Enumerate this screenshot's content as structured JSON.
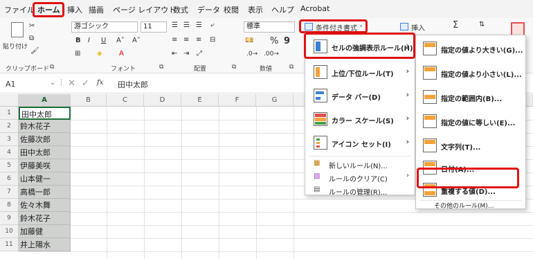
{
  "menubar": {
    "tabs": [
      "ファイル",
      "ホーム",
      "挿入",
      "描画",
      "ページ レイアウト",
      "数式",
      "データ",
      "校閲",
      "表示",
      "ヘルプ",
      "Acrobat"
    ],
    "active_tab": "ホーム"
  },
  "ribbon": {
    "paste_label": "貼り付け",
    "font_name": "游ゴシック",
    "font_size": "11",
    "number_format": "標準",
    "groups": [
      "クリップボード",
      "フォント",
      "配置",
      "数値"
    ],
    "cond_format_label": "条件付き書式",
    "insert_label": "挿入",
    "bold": "B",
    "italic": "I",
    "underline": "U",
    "percent": "%",
    "comma": "9"
  },
  "formula_bar": {
    "name_box": "A1",
    "fx": "fx",
    "content": "田中太郎"
  },
  "grid": {
    "columns": [
      "A",
      "B",
      "C",
      "D",
      "E",
      "F",
      "G"
    ],
    "rows": [
      "1",
      "2",
      "3",
      "4",
      "5",
      "6",
      "7",
      "8",
      "9",
      "10",
      "11"
    ],
    "cells": [
      "田中太郎",
      "鈴木花子",
      "佐藤次郎",
      "田中太郎",
      "伊藤美咲",
      "山本健一",
      "高橋一郎",
      "佐々木舞",
      "鈴木花子",
      "加藤健",
      "井上陽水"
    ]
  },
  "cf_menu": {
    "items": [
      {
        "label": "セルの強調表示ルール(H)",
        "icon": "highlight-rules-icon"
      },
      {
        "label": "上位/下位ルール(T)",
        "icon": "top-bottom-icon"
      },
      {
        "label": "データ バー(D)",
        "icon": "data-bar-icon"
      },
      {
        "label": "カラー スケール(S)",
        "icon": "color-scale-icon"
      },
      {
        "label": "アイコン セット(I)",
        "icon": "icon-set-icon"
      }
    ],
    "small_items": [
      "新しいルール(N)...",
      "ルールのクリア(C)",
      "ルールの管理(R)..."
    ]
  },
  "sub_menu": {
    "items": [
      "指定の値より大きい(G)...",
      "指定の値より小さい(L)...",
      "指定の範囲内(B)...",
      "指定の値に等しい(E)...",
      "文字列(T)...",
      "日付(A)...",
      "重複する値(D)..."
    ],
    "footer": "その他のルール(M)..."
  },
  "colors": {
    "highlight": "#e01010",
    "selection": "#cfd2cf"
  }
}
